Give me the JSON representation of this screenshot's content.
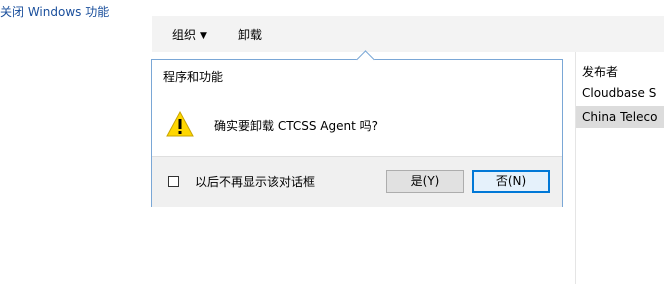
{
  "window": {
    "link_label": "关闭 Windows 功能"
  },
  "toolbar": {
    "organize_label": "组织",
    "organize_caret": "▼",
    "uninstall_label": "卸载"
  },
  "list": {
    "column_header": "发布者",
    "rows": [
      {
        "publisher": "Cloudbase S"
      },
      {
        "publisher": "China Teleco"
      }
    ]
  },
  "dialog": {
    "title": "程序和功能",
    "message": "确实要卸载 CTCSS Agent 吗?",
    "checkbox_label": "以后不再显示该对话框",
    "yes_label": "是(Y)",
    "no_label": "否(N)",
    "icon": "warning-icon"
  },
  "colors": {
    "accent": "#0078d7",
    "warning": "#ffd700",
    "selected_row": "#dcdcdc",
    "link": "#1a4f9c"
  }
}
